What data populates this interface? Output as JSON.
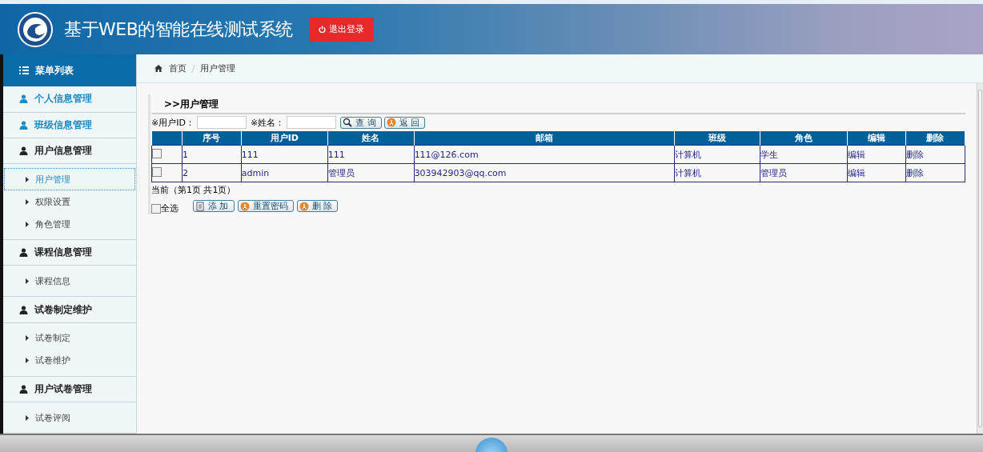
{
  "header": {
    "title": "基于WEB的智能在线测试系统",
    "logout_button": "退出登录"
  },
  "sidebar": {
    "title": "菜单列表",
    "groups": [
      {
        "label": "个人信息管理",
        "expanded": false
      },
      {
        "label": "班级信息管理",
        "expanded": false
      },
      {
        "label": "用户信息管理",
        "expanded": true,
        "children": [
          {
            "label": "用户管理",
            "selected": true
          },
          {
            "label": "权限设置",
            "selected": false
          },
          {
            "label": "角色管理",
            "selected": false
          }
        ]
      },
      {
        "label": "课程信息管理",
        "expanded": true,
        "children": [
          {
            "label": "课程信息",
            "selected": false
          }
        ]
      },
      {
        "label": "试卷制定维护",
        "expanded": true,
        "children": [
          {
            "label": "试卷制定",
            "selected": false
          },
          {
            "label": "试卷维护",
            "selected": false
          }
        ]
      },
      {
        "label": "用户试卷管理",
        "expanded": true,
        "children": [
          {
            "label": "试卷评阅",
            "selected": false
          }
        ]
      }
    ]
  },
  "breadcrumb": [
    "首页",
    "用户管理"
  ],
  "section_title": ">>用户管理",
  "filters": [
    {
      "label": "※用户ID："
    },
    {
      "label": "※姓名："
    }
  ],
  "filter_buttons": [
    {
      "kind": "search",
      "label": "查 询"
    },
    {
      "kind": "back",
      "label": "返 回"
    }
  ],
  "table": {
    "columns": [
      "序号",
      "用户ID",
      "姓名",
      "邮箱",
      "班级",
      "角色",
      "编辑",
      "删除"
    ],
    "rows": [
      {
        "checked": false,
        "cells": [
          "1",
          "111",
          "111",
          "111@126.com",
          "计算机",
          "学生",
          "编辑",
          "删除"
        ]
      },
      {
        "checked": false,
        "cells": [
          "2",
          "admin",
          "管理员",
          "303942903@qq.com",
          "计算机",
          "管理员",
          "编辑",
          "删除"
        ]
      }
    ]
  },
  "pager": "当前（第1页 共1页）",
  "select_all": {
    "label": "全选",
    "checked": false
  },
  "action_buttons": [
    {
      "kind": "add",
      "label": "添 加"
    },
    {
      "kind": "reset",
      "label": "重置密码"
    },
    {
      "kind": "delete",
      "label": "删 除"
    }
  ]
}
